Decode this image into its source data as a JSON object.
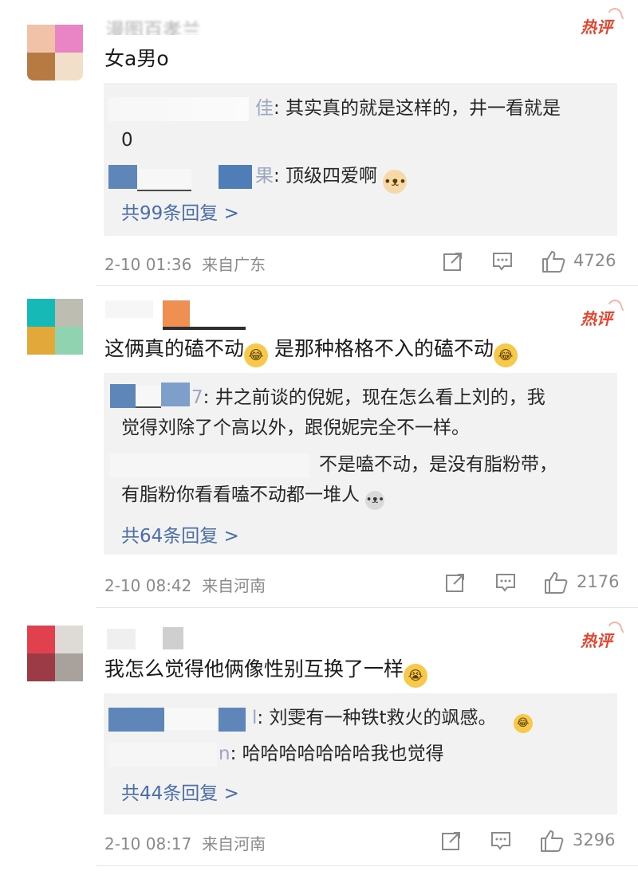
{
  "colors": {
    "hot": "#e8442e",
    "link": "#4a6ea8",
    "reply_bg": "#f2f2f2",
    "meta": "#8a8a8a"
  },
  "comments": [
    {
      "username_partial": "漫图百孝兰",
      "hot_badge": "热评",
      "text": "女a男o",
      "replies": [
        {
          "visible_name_tail": "佳",
          "text": ": 其实真的就是这样的，井一看就是",
          "cont": "0"
        },
        {
          "visible_name_tail": "果",
          "text": ": 顶级四爱啊",
          "emoji": "doge-emoji"
        }
      ],
      "more": "共99条回复 >",
      "time": "2-10 01:36",
      "location": "来自广东",
      "likes": "4726"
    },
    {
      "hot_badge": "热评",
      "text_a": "这俩真的磕不动",
      "text_b": " 是那种格格不入的磕不动",
      "replies": [
        {
          "visible_name_tail": "7",
          "text": ": 井之前谈的倪妮，现在怎么看上刘的，我",
          "cont": "觉得刘除了个高以外，跟倪妮完全不一样。"
        },
        {
          "text": "不是嗑不动，是没有脂粉带，",
          "cont": "有脂粉你看看嗑不动都一堆人"
        }
      ],
      "more": "共64条回复 >",
      "time": "2-10 08:42",
      "location": "来自河南",
      "likes": "2176"
    },
    {
      "hot_badge": "热评",
      "text": "我怎么觉得他俩像性别互换了一样",
      "replies": [
        {
          "visible_name_tail": "l",
          "text": ": 刘雯有一种铁t救火的飒感。"
        },
        {
          "visible_name_tail": "n",
          "text": ": 哈哈哈哈哈哈哈我也觉得"
        }
      ],
      "more": "共44条回复 >",
      "time": "2-10 08:17",
      "location": "来自河南",
      "likes": "3296"
    }
  ]
}
